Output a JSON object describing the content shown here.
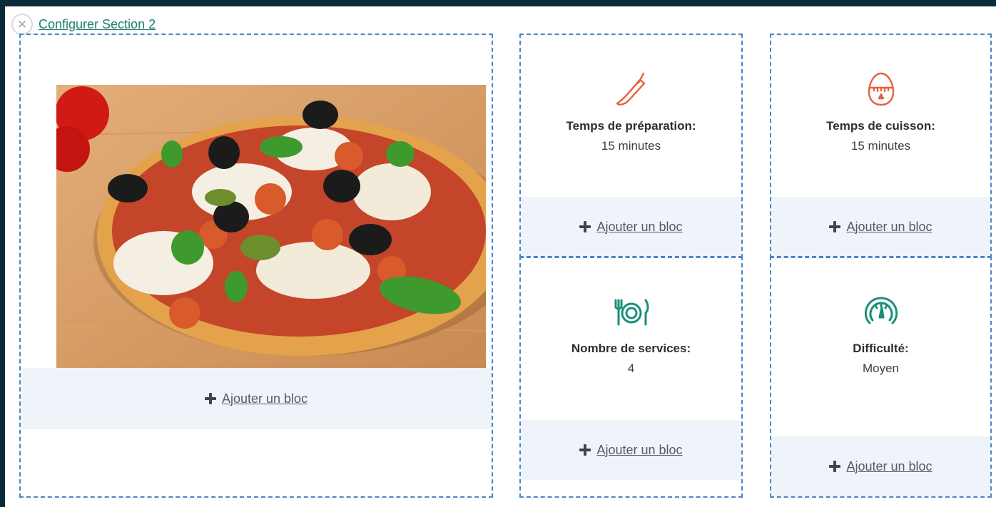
{
  "header": {
    "close_icon": "close-circle-icon",
    "config_link": "Configurer Section 2"
  },
  "image_block": {
    "alt": "Pizza",
    "add_label": "Ajouter un bloc"
  },
  "cards": [
    {
      "icon": "knife-icon",
      "icon_color": "#e8603c",
      "title": "Temps de préparation:",
      "value": "15 minutes",
      "add_label": "Ajouter un bloc"
    },
    {
      "icon": "egg-timer-icon",
      "icon_color": "#e8603c",
      "title": "Temps de cuisson:",
      "value": "15 minutes",
      "add_label": "Ajouter un bloc"
    },
    {
      "icon": "fork-plate-knife-icon",
      "icon_color": "#1a8f7a",
      "title": "Nombre de services:",
      "value": "4",
      "add_label": "Ajouter un bloc"
    },
    {
      "icon": "speedometer-icon",
      "icon_color": "#1a8f7a",
      "title": "Difficulté:",
      "value": "Moyen",
      "add_label": "Ajouter un bloc"
    }
  ],
  "colors": {
    "accent_teal": "#1a8f7a",
    "accent_orange": "#e8603c",
    "dashed_border": "#4b86c5",
    "drop_zone": "#eef4fa",
    "frame": "#0b2a3a"
  }
}
